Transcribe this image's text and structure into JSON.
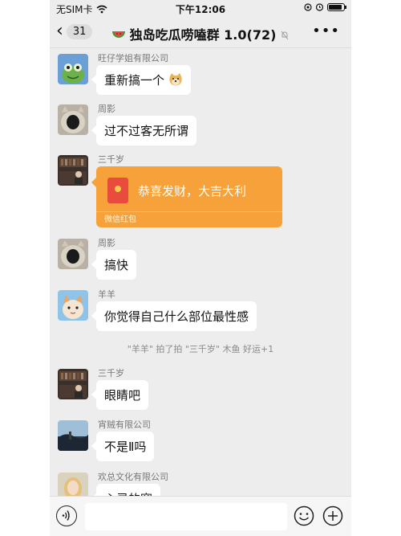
{
  "status_bar": {
    "carrier": "无SIM卡",
    "time": "下午12:06"
  },
  "nav": {
    "back_count": "31",
    "title": "独岛吃瓜唠嗑群 1.0(72)",
    "more": "•••"
  },
  "messages": [
    {
      "sender": "旺仔学姐有限公司",
      "text": "重新搞一个",
      "avatar_icon": "frog-avatar"
    },
    {
      "sender": "周影",
      "text": "过不过客无所谓",
      "avatar_icon": "cat-avatar"
    },
    {
      "sender": "三千岁",
      "red_packet_text": "恭喜发财，大吉大利",
      "red_packet_label": "微信红包",
      "avatar_icon": "library-avatar"
    },
    {
      "sender": "周影",
      "text": "搞快",
      "avatar_icon": "cat-avatar"
    },
    {
      "sender": "羊羊",
      "text": "你觉得自己什么部位最性感",
      "avatar_icon": "cartoon-cat-avatar"
    },
    {
      "sender": "三千岁",
      "text": "眼睛吧",
      "avatar_icon": "library-avatar"
    },
    {
      "sender": "宵贼有限公司",
      "text": "不是Ⅱ吗",
      "avatar_icon": "landscape-avatar"
    },
    {
      "sender": "欢总文化有限公司",
      "text": "心灵的窗",
      "avatar_icon": "girl-avatar"
    }
  ],
  "system_message": "\"羊羊\" 拍了拍 \"三千岁\" 木鱼 好运+1",
  "input_bar": {
    "placeholder": ""
  },
  "colors": {
    "chat_background": "#ededed",
    "bubble": "#ffffff",
    "red_packet": "#f7a13a"
  }
}
